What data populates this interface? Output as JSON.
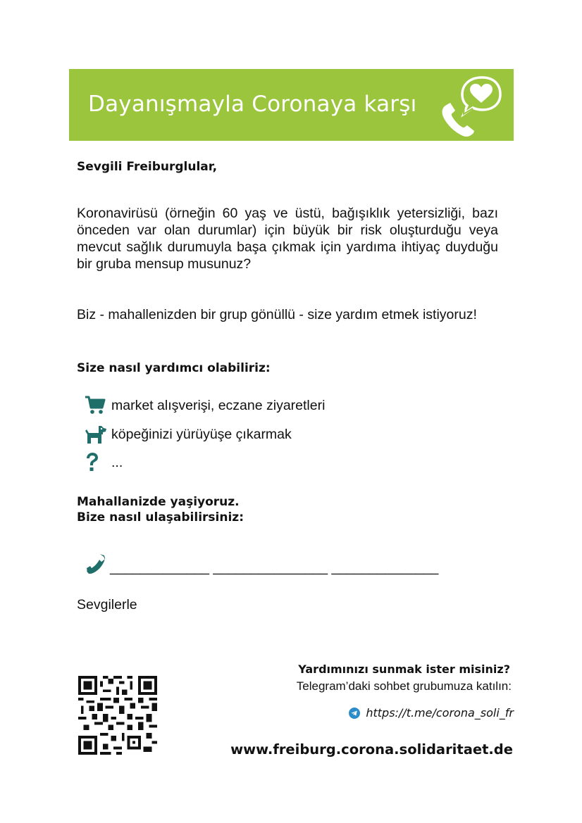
{
  "banner": {
    "title": "Dayanışmayla Coronaya karşı",
    "background_color": "#9bc53d",
    "logo_icon": "phone-heart-speech-bubble-icon"
  },
  "letter": {
    "greeting": "Sevgili Freiburglular,",
    "paragraph_1": "Koronavirüsü (örneğin 60 yaş ve üstü, bağışıklık yetersizliği, bazı önceden var olan durumlar) için büyük bir risk oluşturduğu veya mevcut sağlık durumuyla başa çıkmak için yardıma ihtiyaç duyduğu bir gruba mensup musunuz?",
    "paragraph_2": "Biz - mahallenizden bir grup gönüllü - size yardım etmek istiyoruz!",
    "help_title": "Size nasıl yardımcı olabiliriz:",
    "help_items": [
      {
        "icon": "shopping-cart-icon",
        "label": "market alışverişi, eczane ziyaretleri"
      },
      {
        "icon": "dog-icon",
        "label": "köpeğinizi yürüyüşe çıkarmak"
      },
      {
        "icon": "question-mark-icon",
        "label": "..."
      }
    ],
    "neighborhood_line_1": "Mahallanizde yaşiyoruz.",
    "neighborhood_line_2": "Bize nasıl ulaşabilirsiniz:",
    "phone_blank": "_____________ _______________ ______________",
    "closing": "Sevgilerle"
  },
  "footer": {
    "question": "Yardımınızı sunmak ister misiniz?",
    "telegram_invite": "Telegram’daki sohbet grubumuza katılın:",
    "telegram_link": "https://t.me/corona_soli_fr",
    "website": "www.freiburg.corona.solidaritaet.de"
  },
  "colors": {
    "accent_green": "#9bc53d",
    "icon_teal": "#1f6e6a",
    "telegram_blue": "#2a8dc9"
  }
}
